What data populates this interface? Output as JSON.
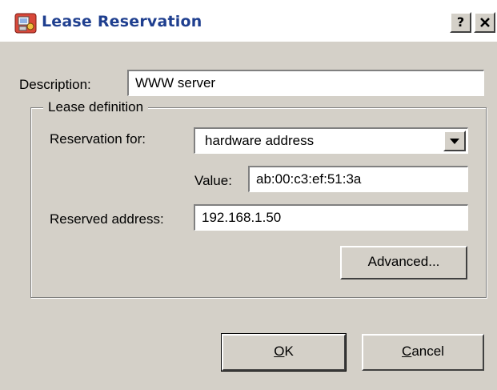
{
  "window": {
    "title": "Lease Reservation",
    "icon": "server-app-icon",
    "help_label": "?",
    "close_label": "✕"
  },
  "description": {
    "label": "Description:",
    "value": "WWW server"
  },
  "lease_definition": {
    "group_label": "Lease definition",
    "reservation_for_label": "Reservation for:",
    "reservation_for_value": "hardware address",
    "value_label": "Value:",
    "value_value": "ab:00:c3:ef:51:3a",
    "reserved_address_label": "Reserved address:",
    "reserved_address_value": "192.168.1.50",
    "advanced_label": "Advanced..."
  },
  "buttons": {
    "ok_mnemonic": "O",
    "ok_rest": "K",
    "cancel_mnemonic": "C",
    "cancel_rest": "ancel"
  },
  "colors": {
    "dialog_bg": "#d4d0c8",
    "title_text": "#1f3f8f",
    "titlebar_bg": "#ffffff"
  }
}
